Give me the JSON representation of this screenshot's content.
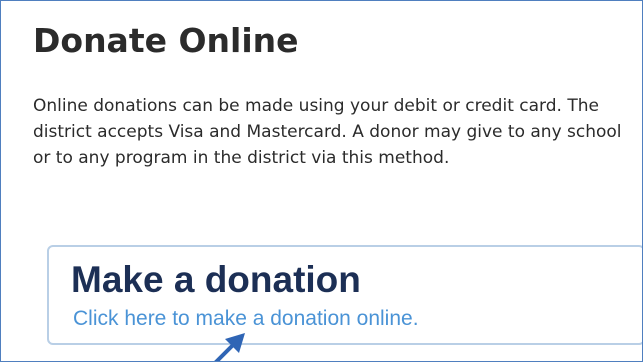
{
  "section": {
    "title": "Donate Online",
    "description": "Online donations can be made using your debit or credit card. The district accepts Visa and Mastercard.  A donor may give to any school or to any program in the district via this method."
  },
  "donation_button": {
    "title": "Make a donation",
    "link_text": "Click here to make a donation online."
  },
  "colors": {
    "frame_border": "#4f7fbf",
    "heading_text": "#2b2b2b",
    "button_title": "#1c2f55",
    "button_link": "#4a93d6",
    "button_border": "#b9cfe6",
    "arrow": "#2f65b5"
  },
  "icons": {
    "pointer": "arrow-icon"
  }
}
